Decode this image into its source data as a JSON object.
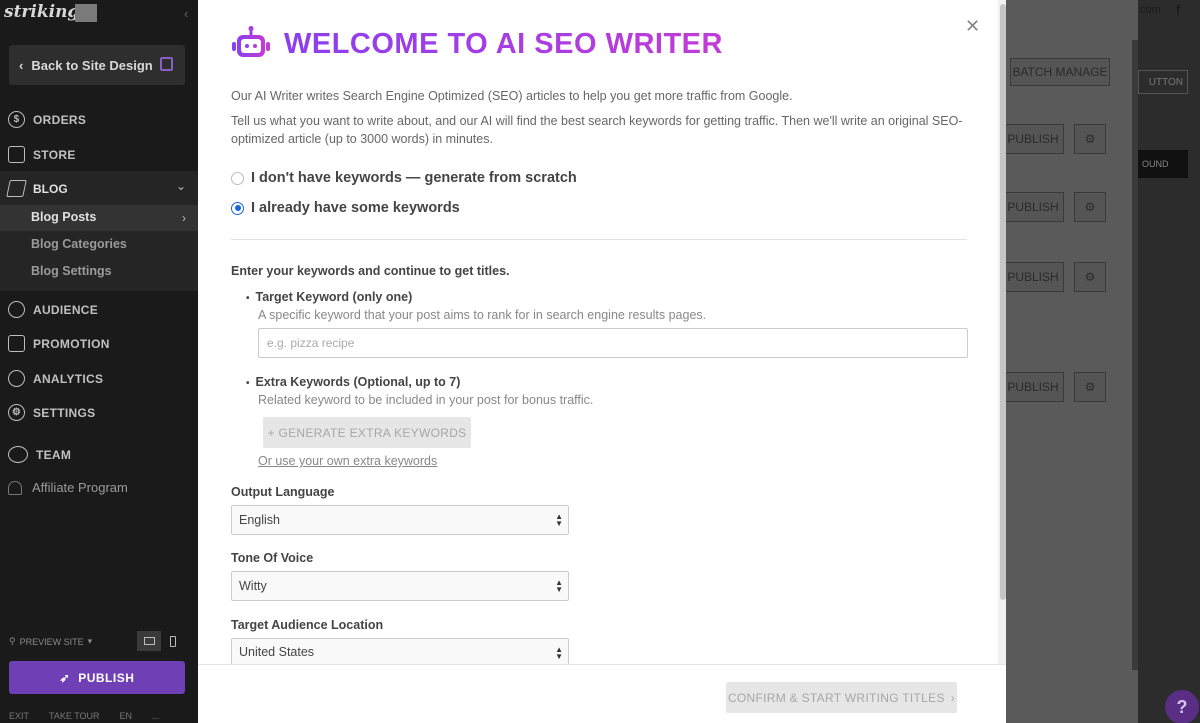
{
  "sidebar": {
    "logo": "strikingly",
    "back_label": "Back to Site Design",
    "items": {
      "orders": "ORDERS",
      "store": "STORE",
      "blog": "BLOG",
      "audience": "AUDIENCE",
      "promotion": "PROMOTION",
      "analytics": "ANALYTICS",
      "settings": "SETTINGS",
      "team": "TEAM",
      "affiliate": "Affiliate Program"
    },
    "blog_sub": [
      "Blog Posts",
      "Blog Categories",
      "Blog Settings"
    ],
    "preview_site": "PREVIEW SITE",
    "publish": "PUBLISH",
    "footer": [
      "EXIT",
      "TAKE TOUR",
      "EN",
      "..."
    ]
  },
  "background": {
    "batch_manage": "BATCH MANAGE",
    "publish": "PUBLISH",
    "corner_text": "com",
    "button_frag": "UTTON",
    "bound_frag": "OUND"
  },
  "modal": {
    "title": "WELCOME TO AI SEO WRITER",
    "intro1": "Our AI Writer writes Search Engine Optimized (SEO) articles to help you get more traffic from Google.",
    "intro2": "Tell us what you want to write about, and our AI will find the best search keywords for getting traffic. Then we'll write an original SEO-optimized article (up to 3000 words) in minutes.",
    "option_scratch": "I don't have keywords — generate from scratch",
    "option_keywords": "I already have some keywords",
    "enter_keywords": "Enter your keywords and continue to get titles.",
    "target_label": "Target Keyword (only one)",
    "target_hint": "A specific keyword that your post aims to rank for in search engine results pages.",
    "target_placeholder": "e.g. pizza recipe",
    "extra_label": "Extra Keywords (Optional, up to 7)",
    "extra_hint": "Related keyword to be included in your post for bonus traffic.",
    "generate_btn": "+ GENERATE EXTRA KEYWORDS",
    "own_link": "Or use your own extra keywords",
    "output_language_label": "Output Language",
    "output_language": "English",
    "tone_label": "Tone Of Voice",
    "tone": "Witty",
    "audience_label": "Target Audience Location",
    "audience": "United States",
    "confirm_btn": "CONFIRM & START WRITING TITLES"
  },
  "help": "?",
  "colors": {
    "accent": "#6f3fb5",
    "title_start": "#8b3ff0",
    "title_end": "#c23cd6",
    "radio": "#1a66d8"
  }
}
